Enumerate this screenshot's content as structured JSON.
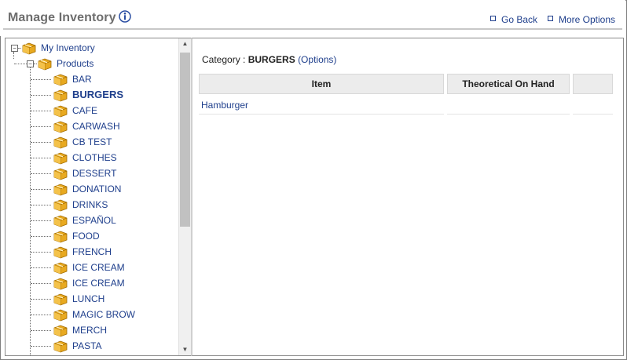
{
  "header": {
    "title": "Manage Inventory",
    "info_icon": "info-icon",
    "go_back": "Go Back",
    "more_options": "More Options"
  },
  "tree": {
    "root": "My Inventory",
    "products": "Products",
    "items": [
      "BAR",
      "BURGERS",
      "CAFE",
      "CARWASH",
      "CB TEST",
      "CLOTHES",
      "DESSERT",
      "DONATION",
      "DRINKS",
      "ESPAÑOL",
      "FOOD",
      "FRENCH",
      "ICE CREAM",
      "ICE CREAM",
      "LUNCH",
      "MAGIC BROW",
      "MERCH",
      "PASTA"
    ],
    "selected": "BURGERS",
    "folder_icon": "folder-box-icon"
  },
  "main": {
    "category_prefix": "Category : ",
    "category_name": "BURGERS",
    "options_link": "(Options)",
    "columns": [
      "Item",
      "Theoretical On Hand",
      ""
    ],
    "rows": [
      [
        "Hamburger",
        "",
        ""
      ]
    ]
  },
  "colors": {
    "link": "#1f3f8c",
    "title_gray": "#6e6e6e",
    "folder_gold": "#e8a920"
  }
}
